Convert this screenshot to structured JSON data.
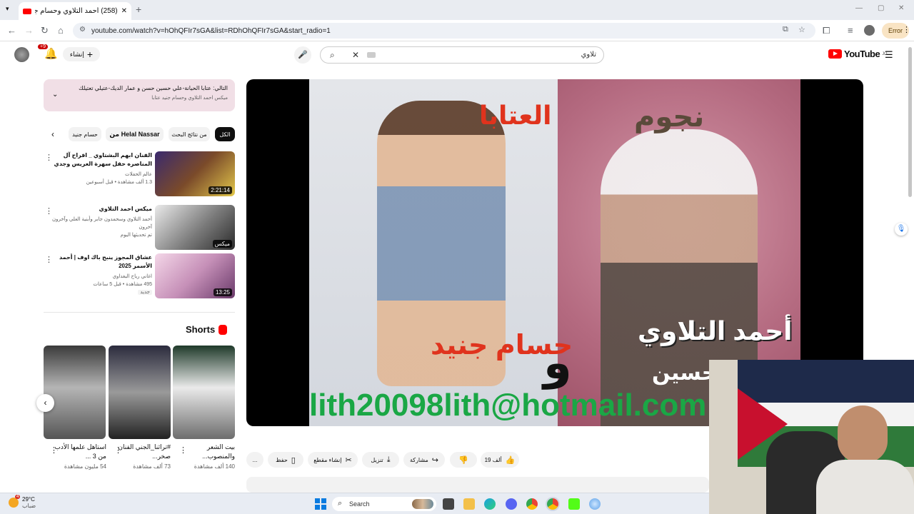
{
  "browser": {
    "tab_title": "(258) أحمد التلاوي وحسام جنيد",
    "url": "youtube.com/watch?v=hOhQFIr7sGA&list=RDhOhQFIr7sGA&start_radio=1",
    "error_label": "Error",
    "new_tab": "+"
  },
  "yt_header": {
    "search_value": "تلاوي",
    "create_label": "إنشاء",
    "notif_badge": "+9",
    "logo_text": "YouTube",
    "logo_region": "JO"
  },
  "next_up": {
    "line1": "التالي: عتابا الحيانة-علي حسين حسن و عمار الديك-عتيلي تعتيلك",
    "line2": "ميكس احمد التلاوي وحسام جنيد عتابا"
  },
  "chips": [
    {
      "label": "الكل"
    },
    {
      "label": "من نتائج البحث"
    },
    {
      "label": "من Helal Nassar"
    },
    {
      "label": "حسام جنيد"
    }
  ],
  "videos": [
    {
      "title": "الفنان ابهم البشتاوي _ افراح آل المناصره حفل سهرة العريس وجدي مناصره _ السهره كامله",
      "channel": "عالم الحفلات",
      "meta": "1.3 ألف مشاهدة • قبل أسبوعين",
      "duration": "2:21:14"
    },
    {
      "title": "ميكس احمد التلاوي",
      "channel": "أحمد التلاوي وسحمدون جابر وأبنية العلي وآخرون آخرون",
      "meta": "تم تحديثها اليوم",
      "duration": "ميكس"
    },
    {
      "title": "عشاق المجوز ينبح باك اوف | أحمد الأسمر 2025",
      "channel": "اغاني رياح البغداوي",
      "meta": "495 مشاهدة • قبل 5 ساعات",
      "badge": "جديد",
      "duration": "13:25"
    }
  ],
  "shorts": {
    "header": "Shorts",
    "items": [
      {
        "title": "بيت الشعر والمنصوب...",
        "views": "140 ألف مشاهدة"
      },
      {
        "title": "#تراثنا_الجني الفنان صخر...",
        "views": "73 ألف مشاهدة"
      },
      {
        "title": "استاهل علمها الأدب من 3 ...",
        "views": "54 مليون مشاهدة"
      }
    ]
  },
  "video_frame": {
    "top_text_right": "نجوم",
    "top_text_left": "العتابا",
    "name_right": "أحمد التلاوي",
    "name_right_sub": "حسين",
    "name_left": "حسام جنيد",
    "connector": "و",
    "email": "lith20098lith@hotmail.com"
  },
  "actions": {
    "likes": "19 ألف",
    "share": "مشاركة",
    "download": "تنزيل",
    "clip": "إنشاء مقطع",
    "save": "حفظ",
    "more": "..."
  },
  "taskbar": {
    "search": "Search",
    "temp": "29°C",
    "weather_text": "ضباب",
    "weather_badge": "4"
  },
  "colors": {
    "accent": "#ff0000",
    "chip_active": "#0f0f0f",
    "next_bg": "#f1dfe6"
  }
}
